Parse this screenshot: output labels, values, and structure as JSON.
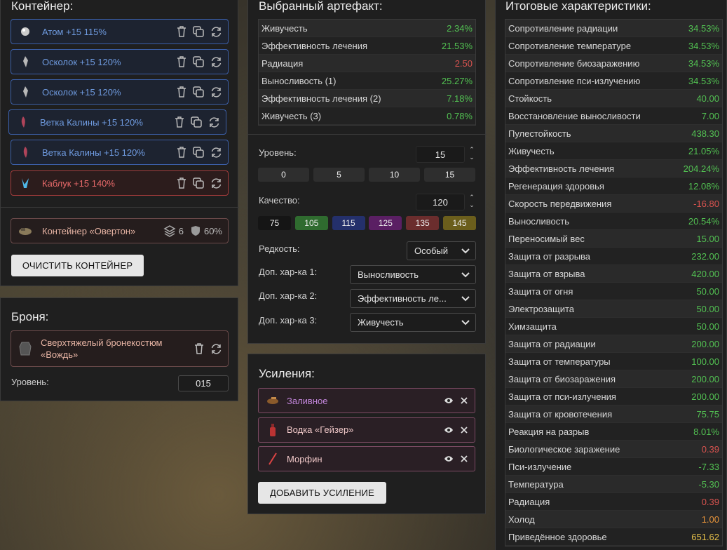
{
  "container": {
    "title": "Контейнер:",
    "slots": [
      {
        "label": "Атом +15 115%",
        "icon": "atom-artifact-icon"
      },
      {
        "label": "Осколок +15 120%",
        "icon": "shard-artifact-icon"
      },
      {
        "label": "Осколок +15 120%",
        "icon": "shard-artifact-icon"
      },
      {
        "label": "Ветка Калины +15 120%",
        "icon": "viburnum-artifact-icon"
      },
      {
        "label": "Ветка Калины +15 120%",
        "icon": "viburnum-artifact-icon"
      },
      {
        "label": "Каблук +15 140%",
        "icon": "heel-artifact-icon"
      }
    ],
    "container_name": "Контейнер «Овертон»",
    "capacity": "6",
    "protection": "60%",
    "clear_label": "ОЧИСТИТЬ КОНТЕЙНЕР"
  },
  "armor": {
    "title": "Броня:",
    "name": "Сверхтяжелый бронекостюм «Вождь»",
    "level_label": "Уровень:",
    "level_value": "015"
  },
  "artifact": {
    "title": "Выбранный артефакт:",
    "stats": [
      {
        "name": "Живучесть",
        "value": "2.34%",
        "color": "g"
      },
      {
        "name": "Эффективность лечения",
        "value": "21.53%",
        "color": "g"
      },
      {
        "name": "Радиация",
        "value": "2.50",
        "color": "r"
      },
      {
        "name": "Выносливость (1)",
        "value": "25.27%",
        "color": "g"
      },
      {
        "name": "Эффективность лечения (2)",
        "value": "7.18%",
        "color": "g"
      },
      {
        "name": "Живучесть (3)",
        "value": "0.78%",
        "color": "g"
      }
    ],
    "level_label": "Уровень:",
    "level_value": "15",
    "level_presets": [
      "0",
      "5",
      "10",
      "15"
    ],
    "quality_label": "Качество:",
    "quality_value": "120",
    "quality_presets": [
      {
        "v": "75",
        "c": "#151515"
      },
      {
        "v": "105",
        "c": "#2f6b2f"
      },
      {
        "v": "115",
        "c": "#24306b"
      },
      {
        "v": "125",
        "c": "#5a1f63"
      },
      {
        "v": "135",
        "c": "#6b2d2d"
      },
      {
        "v": "145",
        "c": "#6b5e1c"
      }
    ],
    "rarity_label": "Редкость:",
    "rarity_value": "Особый",
    "extra1_label": "Доп. хар-ка 1:",
    "extra1_value": "Выносливость",
    "extra2_label": "Доп. хар-ка 2:",
    "extra2_value": "Эффективность ле...",
    "extra3_label": "Доп. хар-ка 3:",
    "extra3_value": "Живучесть"
  },
  "boosts": {
    "title": "Усиления:",
    "items": [
      {
        "label": "Заливное",
        "color": "#c084d8"
      },
      {
        "label": "Водка «Гейзер»",
        "color": "#f0c8c8"
      },
      {
        "label": "Морфин",
        "color": "#f0c8c8"
      }
    ],
    "add_label": "ДОБАВИТЬ УСИЛЕНИЕ"
  },
  "totals": {
    "title": "Итоговые характеристики:",
    "rows": [
      {
        "name": "Сопротивление радиации",
        "value": "34.53%",
        "color": "g"
      },
      {
        "name": "Сопротивление температуре",
        "value": "34.53%",
        "color": "g"
      },
      {
        "name": "Сопротивление биозаражению",
        "value": "34.53%",
        "color": "g"
      },
      {
        "name": "Сопротивление пси-излучению",
        "value": "34.53%",
        "color": "g"
      },
      {
        "name": "Стойкость",
        "value": "40.00",
        "color": "g"
      },
      {
        "name": "Восстановление выносливости",
        "value": "7.00",
        "color": "g"
      },
      {
        "name": "Пулестойкость",
        "value": "438.30",
        "color": "g"
      },
      {
        "name": "Живучесть",
        "value": "21.05%",
        "color": "g"
      },
      {
        "name": "Эффективность лечения",
        "value": "204.24%",
        "color": "g"
      },
      {
        "name": "Регенерация здоровья",
        "value": "12.08%",
        "color": "g"
      },
      {
        "name": "Скорость передвижения",
        "value": "-16.80",
        "color": "r"
      },
      {
        "name": "Выносливость",
        "value": "20.54%",
        "color": "g"
      },
      {
        "name": "Переносимый вес",
        "value": "15.00",
        "color": "g"
      },
      {
        "name": "Защита от разрыва",
        "value": "232.00",
        "color": "g"
      },
      {
        "name": "Защита от взрыва",
        "value": "420.00",
        "color": "g"
      },
      {
        "name": "Защита от огня",
        "value": "50.00",
        "color": "g"
      },
      {
        "name": "Электрозащита",
        "value": "50.00",
        "color": "g"
      },
      {
        "name": "Химзащита",
        "value": "50.00",
        "color": "g"
      },
      {
        "name": "Защита от радиации",
        "value": "200.00",
        "color": "g"
      },
      {
        "name": "Защита от температуры",
        "value": "100.00",
        "color": "g"
      },
      {
        "name": "Защита от биозаражения",
        "value": "200.00",
        "color": "g"
      },
      {
        "name": "Защита от пси-излучения",
        "value": "200.00",
        "color": "g"
      },
      {
        "name": "Защита от кровотечения",
        "value": "75.75",
        "color": "g"
      },
      {
        "name": "Реакция на разрыв",
        "value": "8.01%",
        "color": "g"
      },
      {
        "name": "Биологическое заражение",
        "value": "0.39",
        "color": "r"
      },
      {
        "name": "Пси-излучение",
        "value": "-7.33",
        "color": "g"
      },
      {
        "name": "Температура",
        "value": "-5.30",
        "color": "g"
      },
      {
        "name": "Радиация",
        "value": "0.39",
        "color": "r"
      },
      {
        "name": "Холод",
        "value": "1.00",
        "color": "o"
      },
      {
        "name": "Приведённое здоровье",
        "value": "651.62",
        "color": "y"
      }
    ]
  }
}
